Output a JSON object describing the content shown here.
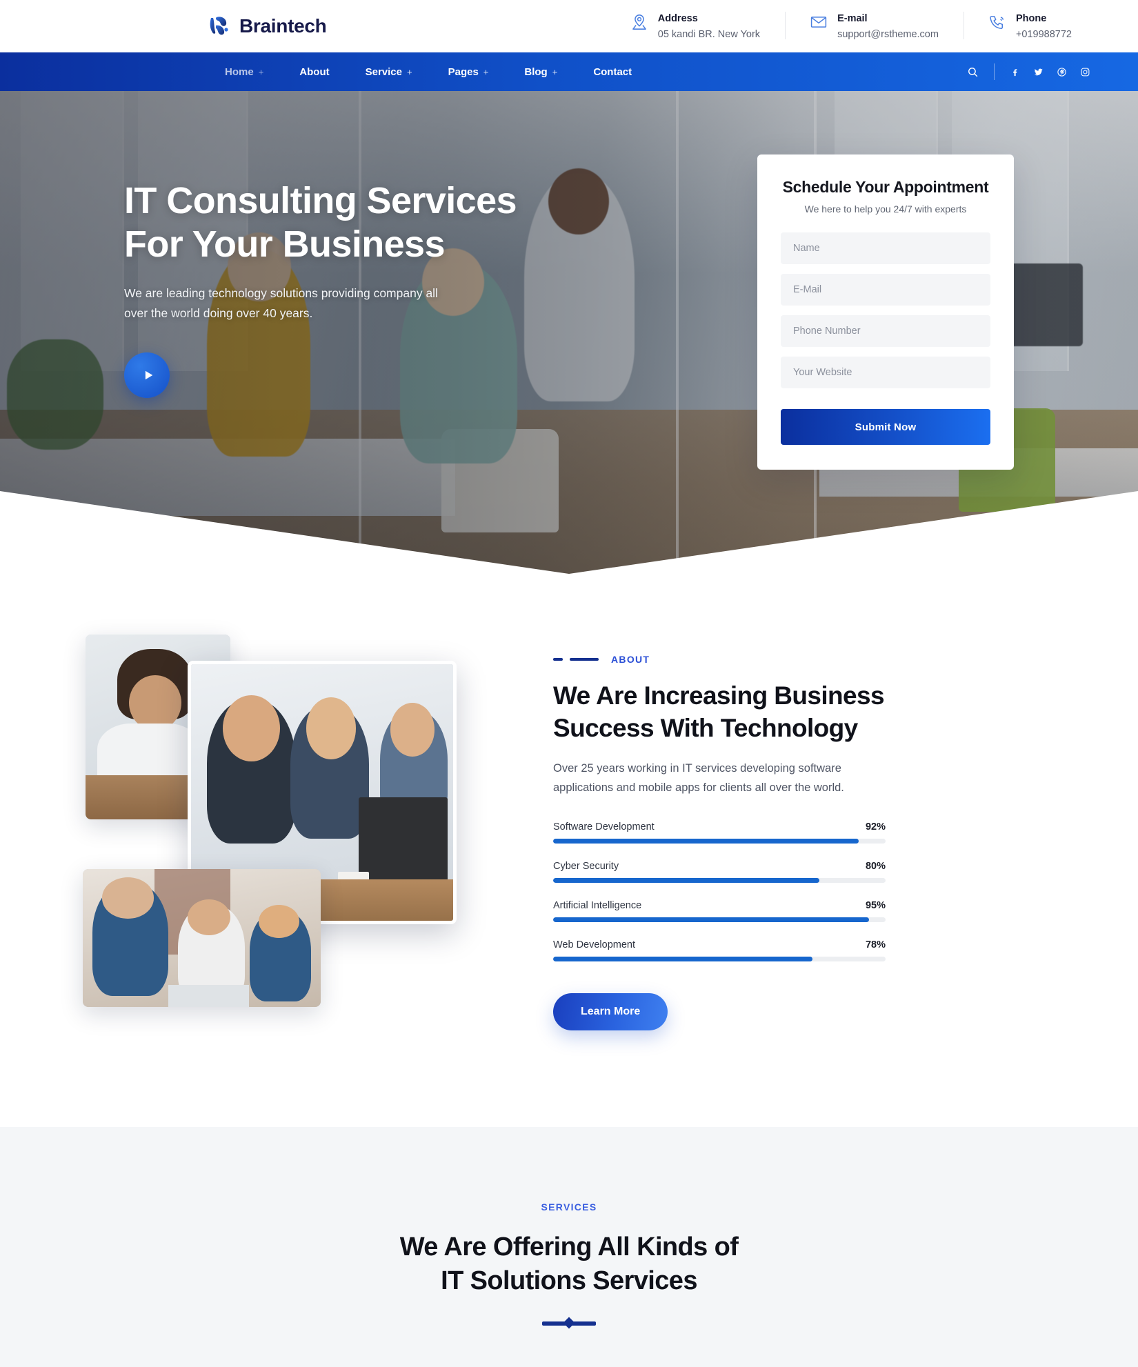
{
  "brand": {
    "name": "Braintech",
    "logo_icon": "braintech-logo-icon"
  },
  "topbar": {
    "contacts": [
      {
        "icon": "location-pin-icon",
        "title": "Address",
        "value": "05 kandi BR. New York"
      },
      {
        "icon": "envelope-icon",
        "title": "E-mail",
        "value": "support@rstheme.com"
      },
      {
        "icon": "phone-icon",
        "title": "Phone",
        "value": "+019988772"
      }
    ]
  },
  "nav": {
    "items": [
      {
        "label": "Home",
        "has_dropdown": true,
        "plus": "+",
        "active": true
      },
      {
        "label": "About",
        "has_dropdown": false,
        "plus": ""
      },
      {
        "label": "Service",
        "has_dropdown": true,
        "plus": "+"
      },
      {
        "label": "Pages",
        "has_dropdown": true,
        "plus": "+"
      },
      {
        "label": "Blog",
        "has_dropdown": true,
        "plus": "+"
      },
      {
        "label": "Contact",
        "has_dropdown": false,
        "plus": ""
      }
    ],
    "search_icon": "search-icon",
    "socials": [
      {
        "name": "facebook-icon"
      },
      {
        "name": "twitter-icon"
      },
      {
        "name": "pinterest-icon"
      },
      {
        "name": "instagram-icon"
      }
    ]
  },
  "hero": {
    "title_line1": "IT Consulting Services",
    "title_line2": "For Your Business",
    "description": "We are leading technology solutions providing company all over the world doing over 40 years.",
    "play_icon": "play-icon"
  },
  "appointment": {
    "title": "Schedule Your Appointment",
    "subtitle": "We here to help you 24/7 with experts",
    "fields": [
      {
        "name": "name-field",
        "placeholder": "Name",
        "value": ""
      },
      {
        "name": "email-field",
        "placeholder": "E-Mail",
        "value": ""
      },
      {
        "name": "phone-field",
        "placeholder": "Phone Number",
        "value": ""
      },
      {
        "name": "website-field",
        "placeholder": "Your Website",
        "value": ""
      }
    ],
    "submit_label": "Submit Now"
  },
  "about": {
    "eyebrow": "ABOUT",
    "heading_line1": "We Are Increasing Business Success",
    "heading_line2": "With Technology",
    "paragraph": "Over 25 years working in IT services developing software applications and mobile apps for clients all over the world.",
    "button_label": "Learn More",
    "skills": [
      {
        "label": "Software Development",
        "value": "92%",
        "percent": 92
      },
      {
        "label": "Cyber Security",
        "value": "80%",
        "percent": 80
      },
      {
        "label": "Artificial Intelligence",
        "value": "95%",
        "percent": 95
      },
      {
        "label": "Web Development",
        "value": "78%",
        "percent": 78
      }
    ]
  },
  "services": {
    "eyebrow": "SERVICES",
    "title_line1": "We Are Offering All Kinds of",
    "title_line2": "IT Solutions Services"
  },
  "colors": {
    "brand_navy": "#171a4a",
    "nav_gradient_start": "#0b2f9e",
    "nav_gradient_end": "#1668e3",
    "accent_blue": "#1666cd",
    "eyebrow_blue": "#2b4fd6",
    "rule_navy": "#14308f",
    "section_bg": "#f4f6f8"
  }
}
